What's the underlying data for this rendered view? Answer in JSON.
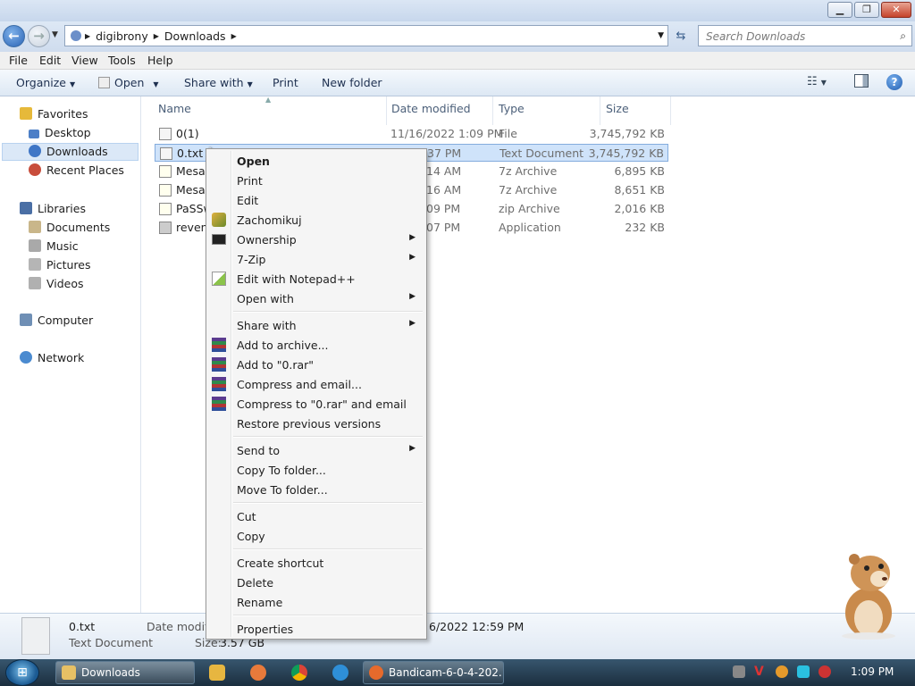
{
  "window": {
    "min": "▁",
    "max": "❐",
    "close": "✕"
  },
  "address": {
    "seg1": "digibrony",
    "seg2": "Downloads",
    "search_placeholder": "Search Downloads"
  },
  "menubar": {
    "file": "File",
    "edit": "Edit",
    "view": "View",
    "tools": "Tools",
    "help": "Help"
  },
  "toolbar": {
    "organize": "Organize",
    "open": "Open",
    "share": "Share with",
    "print": "Print",
    "newfolder": "New folder"
  },
  "nav": {
    "favorites": "Favorites",
    "desktop": "Desktop",
    "downloads": "Downloads",
    "recent": "Recent Places",
    "libraries": "Libraries",
    "documents": "Documents",
    "music": "Music",
    "pictures": "Pictures",
    "videos": "Videos",
    "computer": "Computer",
    "network": "Network"
  },
  "columns": {
    "name": "Name",
    "date": "Date modified",
    "type": "Type",
    "size": "Size"
  },
  "files": [
    {
      "name": "0(1)",
      "date": "11/16/2022 1:09 PM",
      "type": "File",
      "size": "3,745,792 KB"
    },
    {
      "name": "0.txt",
      "date": "022 2:37 PM",
      "type": "Text Document",
      "size": "3,745,792 KB"
    },
    {
      "name": "MesaF",
      "date": "022 2:14 AM",
      "type": "7z Archive",
      "size": "6,895 KB"
    },
    {
      "name": "MesaF",
      "date": "022 2:16 AM",
      "type": "7z Archive",
      "size": "8,651 KB"
    },
    {
      "name": "PaSSw",
      "date": "022 1:09 PM",
      "type": "zip Archive",
      "size": "2,016 KB"
    },
    {
      "name": "reveng",
      "date": "022 1:07 PM",
      "type": "Application",
      "size": "232 KB"
    }
  ],
  "context_menu": {
    "open": "Open",
    "print": "Print",
    "edit": "Edit",
    "zachomikuj": "Zachomikuj",
    "ownership": "Ownership",
    "zip7": "7-Zip",
    "notepad": "Edit with Notepad++",
    "openwith": "Open with",
    "sharewith": "Share with",
    "addarchive": "Add to archive...",
    "addrar": "Add to \"0.rar\"",
    "compressemail": "Compress and email...",
    "compressrar": "Compress to \"0.rar\" and email",
    "restore": "Restore previous versions",
    "sendto": "Send to",
    "copyto": "Copy To folder...",
    "moveto": "Move To folder...",
    "cut": "Cut",
    "copy": "Copy",
    "shortcut": "Create shortcut",
    "delete": "Delete",
    "rename": "Rename",
    "properties": "Properties"
  },
  "details": {
    "name": "0.txt",
    "type": "Text Document",
    "date_label": "Date modifie",
    "date_value": "6/2022 12:59 PM",
    "size_label": "Size:",
    "size_value": "3.57 GB"
  },
  "taskbar": {
    "explorer": "Downloads",
    "bandicam": "Bandicam-6-0-4-202...",
    "clock": "1:09 PM"
  }
}
